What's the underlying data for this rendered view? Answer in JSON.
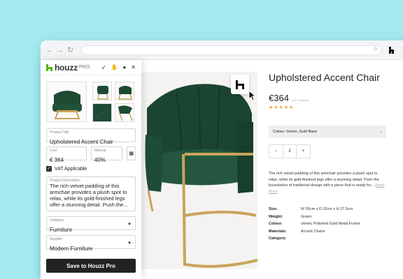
{
  "product_panel": {
    "brand": "houzz",
    "brand_suffix": "PRO",
    "title_label": "Product Title",
    "title_value": "Upholstered Accent Chair",
    "cost_label": "Cost",
    "cost_value": "€ 364",
    "markup_label": "Markup",
    "markup_value": "40%",
    "vat_label": "VAT Applicable",
    "vat_checked": true,
    "description_label": "Product Description",
    "description_value": "The rich velvet padding of this armchair provides a plush spot to relax, while its gold-finished legs offer a stunning detail. Push the...",
    "category_label": "Category",
    "category_value": "Furniture",
    "supplier_label": "Supplier",
    "supplier_value": "Modern Furniture",
    "save_label": "Save to Houzz Pro"
  },
  "product": {
    "title": "Upholstered Accent Chair",
    "price": "€364",
    "shipping": "1.60 Shipping",
    "stars": "★★★★★",
    "colour_select": "Colour: Green, Gold Base",
    "qty_minus": "−",
    "qty_value": "2",
    "qty_plus": "+",
    "description": "The rich velvet padding of this armchair provides a plush spot to relax, while its gold-finished legs offer a stunning detail. Push the boundaries of traditional design with a piece that is ready for...",
    "read_more": "Read More",
    "specs": [
      {
        "key": "Size:",
        "value": "W 55cm x D 32cm x H 27.5cm"
      },
      {
        "key": "Weight:",
        "value": "Green"
      },
      {
        "key": "Colour:",
        "value": "Velvet, Polished Gold Metal Frame"
      },
      {
        "key": "Materials:",
        "value": "Accent Chairs"
      },
      {
        "key": "Category:",
        "value": ""
      }
    ]
  },
  "colors": {
    "background": "#a3eaf0",
    "houzz_green": "#4dbc15",
    "chair_green": "#1e4a34",
    "gold": "#c9a45a",
    "star": "#f0a63b"
  },
  "icons": [
    "back-icon",
    "forward-icon",
    "reload-icon",
    "star-icon",
    "houzz-extension-icon",
    "more-icon",
    "pointer-tool-icon",
    "hand-tool-icon",
    "user-icon",
    "close-icon",
    "calculator-icon",
    "chevron-down-icon",
    "cursor-icon"
  ]
}
